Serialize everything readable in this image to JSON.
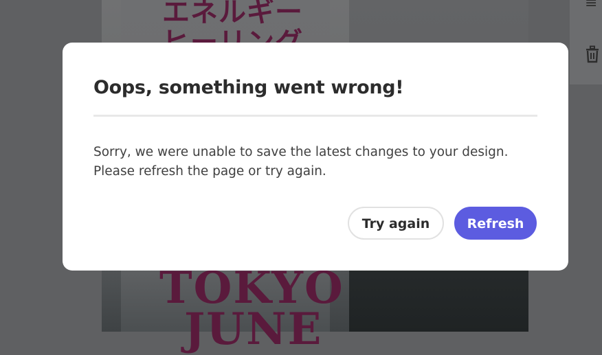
{
  "background": {
    "poster_japanese_line1": "エネルギー",
    "poster_japanese_line2": "ヒーリング",
    "poster_title_line1": "TOKYO",
    "poster_title_line2": "JUNE",
    "panel_icons": [
      "list-icon",
      "trash-icon"
    ]
  },
  "dialog": {
    "title": "Oops, something went wrong!",
    "body": "Sorry, we were unable to save the latest changes to your design. Please refresh the page or try again.",
    "secondary_button_label": "Try again",
    "primary_button_label": "Refresh"
  },
  "colors": {
    "overlay": "#5f6062",
    "dialog_background": "#ffffff",
    "primary_button": "#5c5ce0",
    "poster_text": "#5a1a3c"
  }
}
